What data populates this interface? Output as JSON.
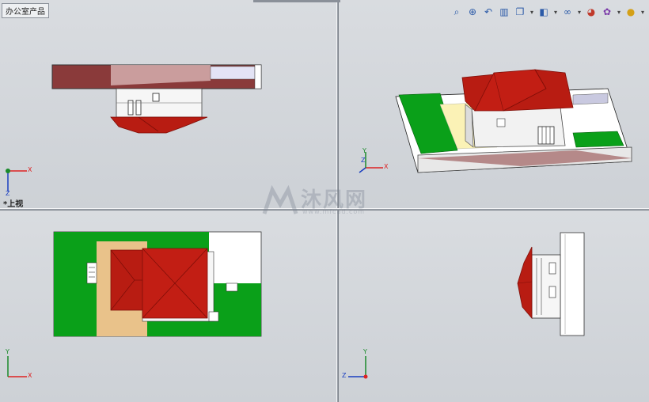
{
  "tab": {
    "assembly_name": "办公室产品"
  },
  "viewport_top_left": {
    "view_label": "*上视"
  },
  "toolbar": {
    "buttons": [
      {
        "icon": "zoom-to-fit-icon",
        "glyph": "⌕"
      },
      {
        "icon": "zoom-area-icon",
        "glyph": "⊕"
      },
      {
        "icon": "previous-view-icon",
        "glyph": "↶"
      },
      {
        "icon": "section-view-icon",
        "glyph": "▥"
      },
      {
        "icon": "view-orientation-icon",
        "glyph": "❐"
      },
      {
        "icon": "display-style-icon",
        "glyph": "◧"
      },
      {
        "icon": "hide-show-items-icon",
        "glyph": "∞"
      },
      {
        "icon": "edit-appearance-icon",
        "glyph": "◕"
      },
      {
        "icon": "apply-scene-icon",
        "glyph": "✿"
      },
      {
        "icon": "view-settings-icon",
        "glyph": "●"
      }
    ]
  },
  "watermark": {
    "text": "沐风网",
    "url": "www.mfcad.com"
  },
  "triads": {
    "x": "X",
    "y": "Y",
    "z": "Z"
  },
  "colors": {
    "roof": "#b81c12",
    "roof_dark": "#7f0e08",
    "grass": "#0aa019",
    "sand": "#e9c28a",
    "wall": "#f6f6f6",
    "slab_brown": "#8a3a3a"
  }
}
